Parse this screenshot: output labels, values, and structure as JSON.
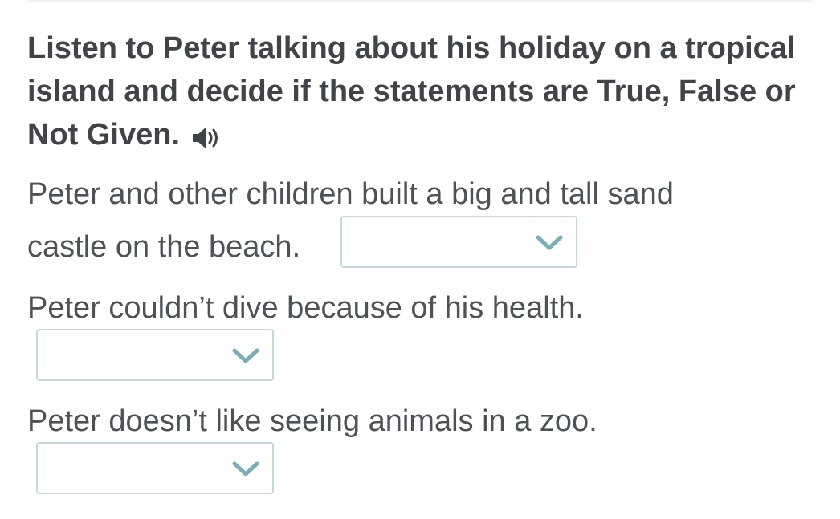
{
  "exercise": {
    "instruction": "Listen to Peter talking about his holiday on a tropical island and decide if the statements are True, False or Not Given.",
    "audio_icon": "speaker-icon",
    "accent_color": "#7aaeb7",
    "questions": [
      {
        "text_line1": "Peter and other children built a big and tall sand",
        "text_line2": "castle on the beach.",
        "selected_value": ""
      },
      {
        "text": "Peter couldn’t dive because of his health.",
        "selected_value": ""
      },
      {
        "text": "Peter doesn’t like seeing animals in a zoo.",
        "selected_value": ""
      }
    ]
  }
}
